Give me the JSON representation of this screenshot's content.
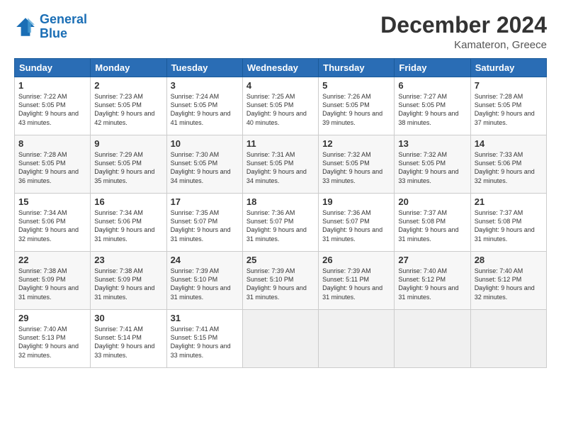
{
  "logo": {
    "line1": "General",
    "line2": "Blue"
  },
  "title": "December 2024",
  "subtitle": "Kamateron, Greece",
  "header_days": [
    "Sunday",
    "Monday",
    "Tuesday",
    "Wednesday",
    "Thursday",
    "Friday",
    "Saturday"
  ],
  "weeks": [
    [
      {
        "day": "1",
        "sunrise": "7:22 AM",
        "sunset": "5:05 PM",
        "daylight": "9 hours and 43 minutes."
      },
      {
        "day": "2",
        "sunrise": "7:23 AM",
        "sunset": "5:05 PM",
        "daylight": "9 hours and 42 minutes."
      },
      {
        "day": "3",
        "sunrise": "7:24 AM",
        "sunset": "5:05 PM",
        "daylight": "9 hours and 41 minutes."
      },
      {
        "day": "4",
        "sunrise": "7:25 AM",
        "sunset": "5:05 PM",
        "daylight": "9 hours and 40 minutes."
      },
      {
        "day": "5",
        "sunrise": "7:26 AM",
        "sunset": "5:05 PM",
        "daylight": "9 hours and 39 minutes."
      },
      {
        "day": "6",
        "sunrise": "7:27 AM",
        "sunset": "5:05 PM",
        "daylight": "9 hours and 38 minutes."
      },
      {
        "day": "7",
        "sunrise": "7:28 AM",
        "sunset": "5:05 PM",
        "daylight": "9 hours and 37 minutes."
      }
    ],
    [
      {
        "day": "8",
        "sunrise": "7:28 AM",
        "sunset": "5:05 PM",
        "daylight": "9 hours and 36 minutes."
      },
      {
        "day": "9",
        "sunrise": "7:29 AM",
        "sunset": "5:05 PM",
        "daylight": "9 hours and 35 minutes."
      },
      {
        "day": "10",
        "sunrise": "7:30 AM",
        "sunset": "5:05 PM",
        "daylight": "9 hours and 34 minutes."
      },
      {
        "day": "11",
        "sunrise": "7:31 AM",
        "sunset": "5:05 PM",
        "daylight": "9 hours and 34 minutes."
      },
      {
        "day": "12",
        "sunrise": "7:32 AM",
        "sunset": "5:05 PM",
        "daylight": "9 hours and 33 minutes."
      },
      {
        "day": "13",
        "sunrise": "7:32 AM",
        "sunset": "5:05 PM",
        "daylight": "9 hours and 33 minutes."
      },
      {
        "day": "14",
        "sunrise": "7:33 AM",
        "sunset": "5:06 PM",
        "daylight": "9 hours and 32 minutes."
      }
    ],
    [
      {
        "day": "15",
        "sunrise": "7:34 AM",
        "sunset": "5:06 PM",
        "daylight": "9 hours and 32 minutes."
      },
      {
        "day": "16",
        "sunrise": "7:34 AM",
        "sunset": "5:06 PM",
        "daylight": "9 hours and 31 minutes."
      },
      {
        "day": "17",
        "sunrise": "7:35 AM",
        "sunset": "5:07 PM",
        "daylight": "9 hours and 31 minutes."
      },
      {
        "day": "18",
        "sunrise": "7:36 AM",
        "sunset": "5:07 PM",
        "daylight": "9 hours and 31 minutes."
      },
      {
        "day": "19",
        "sunrise": "7:36 AM",
        "sunset": "5:07 PM",
        "daylight": "9 hours and 31 minutes."
      },
      {
        "day": "20",
        "sunrise": "7:37 AM",
        "sunset": "5:08 PM",
        "daylight": "9 hours and 31 minutes."
      },
      {
        "day": "21",
        "sunrise": "7:37 AM",
        "sunset": "5:08 PM",
        "daylight": "9 hours and 31 minutes."
      }
    ],
    [
      {
        "day": "22",
        "sunrise": "7:38 AM",
        "sunset": "5:09 PM",
        "daylight": "9 hours and 31 minutes."
      },
      {
        "day": "23",
        "sunrise": "7:38 AM",
        "sunset": "5:09 PM",
        "daylight": "9 hours and 31 minutes."
      },
      {
        "day": "24",
        "sunrise": "7:39 AM",
        "sunset": "5:10 PM",
        "daylight": "9 hours and 31 minutes."
      },
      {
        "day": "25",
        "sunrise": "7:39 AM",
        "sunset": "5:10 PM",
        "daylight": "9 hours and 31 minutes."
      },
      {
        "day": "26",
        "sunrise": "7:39 AM",
        "sunset": "5:11 PM",
        "daylight": "9 hours and 31 minutes."
      },
      {
        "day": "27",
        "sunrise": "7:40 AM",
        "sunset": "5:12 PM",
        "daylight": "9 hours and 31 minutes."
      },
      {
        "day": "28",
        "sunrise": "7:40 AM",
        "sunset": "5:12 PM",
        "daylight": "9 hours and 32 minutes."
      }
    ],
    [
      {
        "day": "29",
        "sunrise": "7:40 AM",
        "sunset": "5:13 PM",
        "daylight": "9 hours and 32 minutes."
      },
      {
        "day": "30",
        "sunrise": "7:41 AM",
        "sunset": "5:14 PM",
        "daylight": "9 hours and 33 minutes."
      },
      {
        "day": "31",
        "sunrise": "7:41 AM",
        "sunset": "5:15 PM",
        "daylight": "9 hours and 33 minutes."
      },
      null,
      null,
      null,
      null
    ]
  ]
}
